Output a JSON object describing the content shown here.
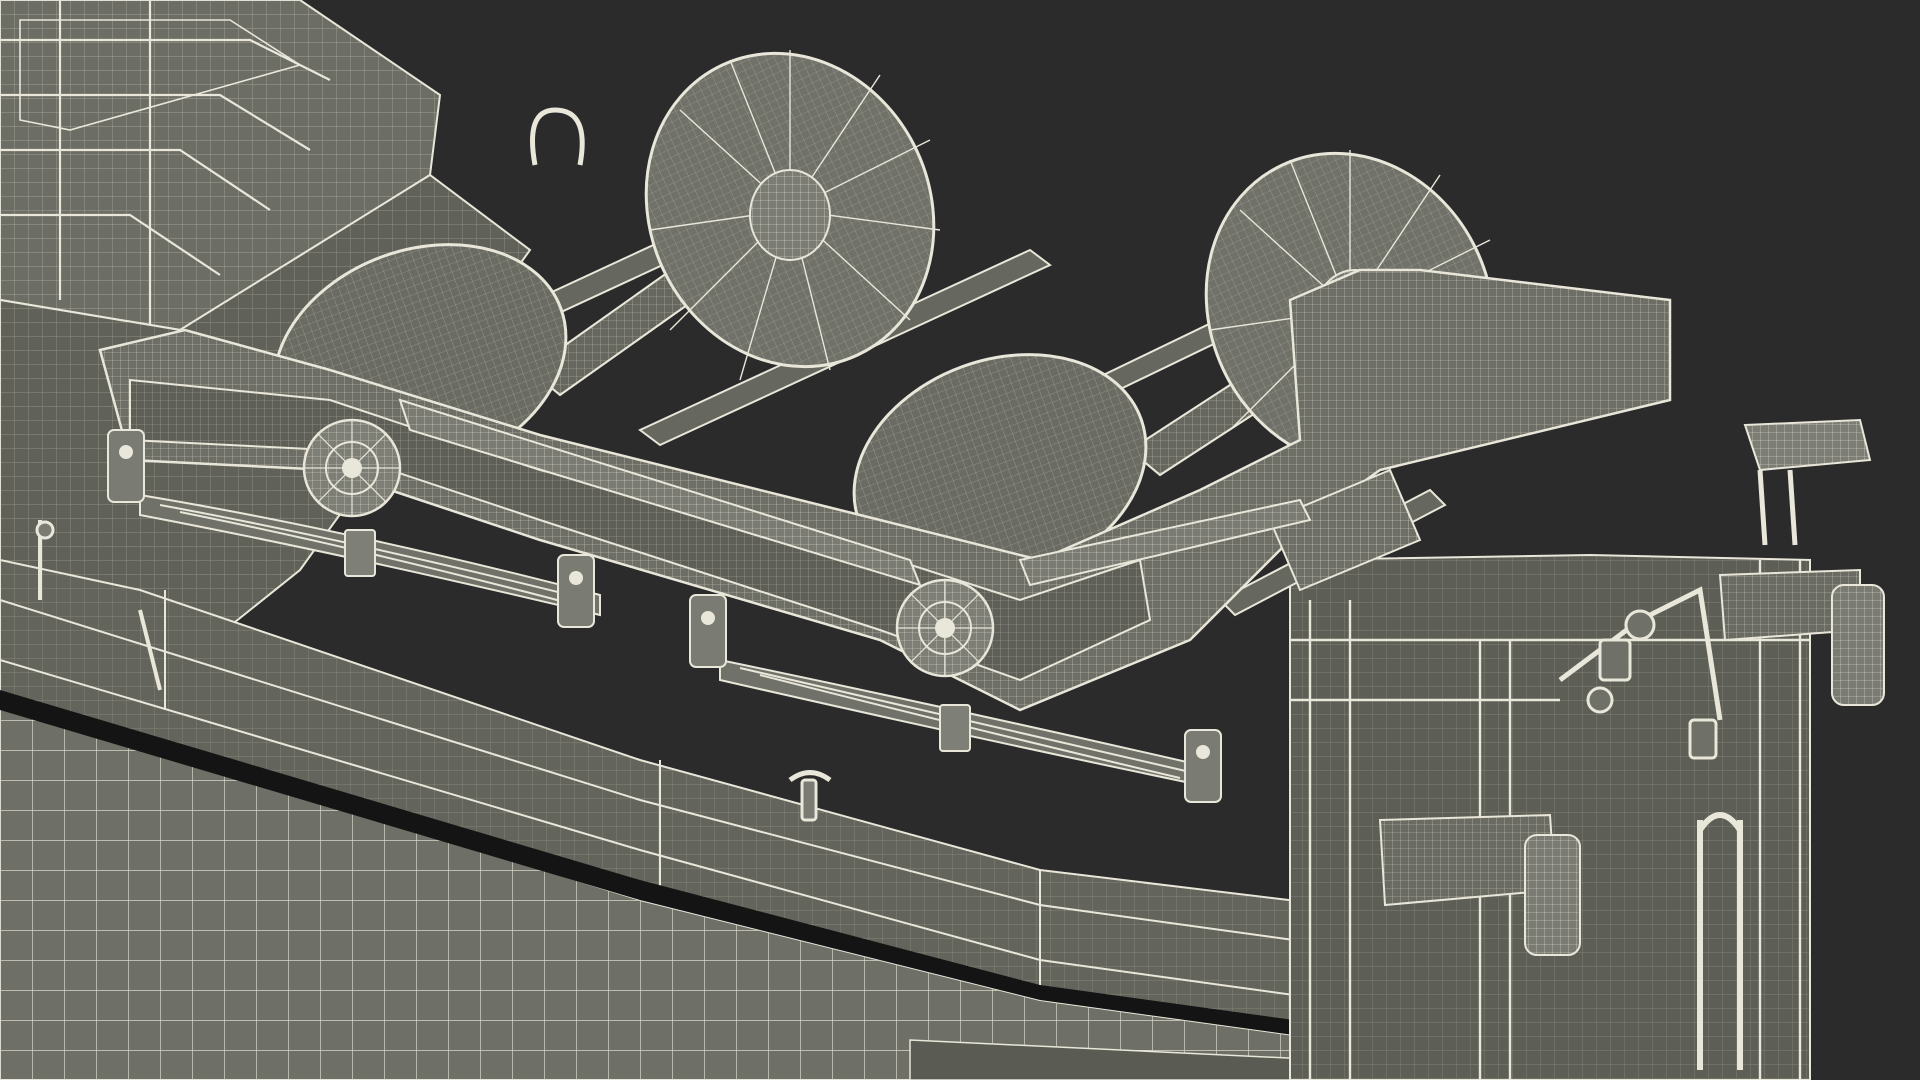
{
  "scene": {
    "subject": "wireframe-render-railcar-underside-bogie",
    "colors": {
      "background": "#2b2b2b",
      "surface": "#6b6c63",
      "surface_dark": "#4f504a",
      "surface_light": "#8a8b81",
      "shadow": "#151515",
      "wire": "#e9e6da",
      "wire_soft": "#c9c6ba"
    }
  }
}
